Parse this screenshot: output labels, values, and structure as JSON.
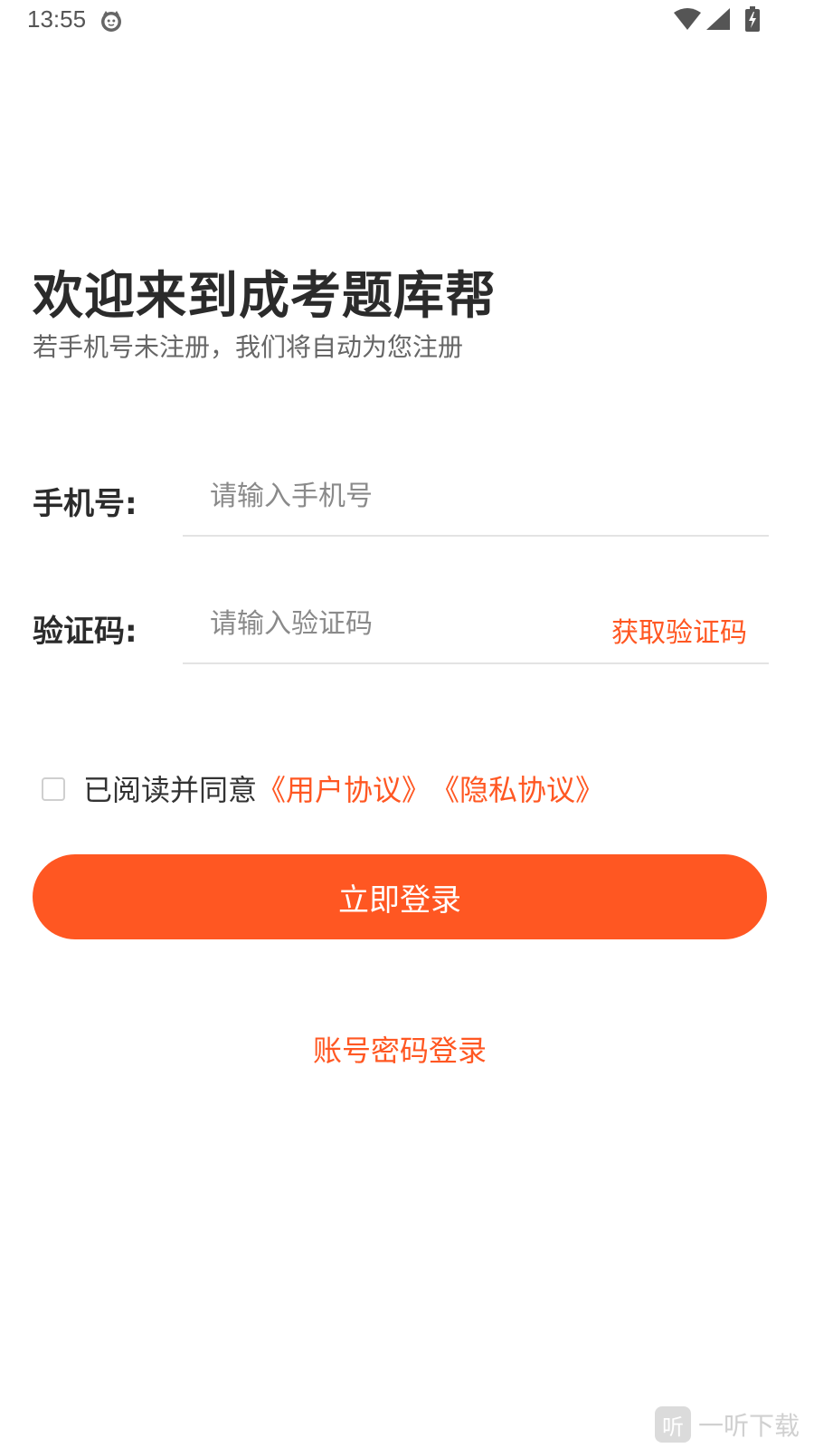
{
  "status_bar": {
    "time": "13:55",
    "icons": [
      "face-icon",
      "wifi-icon",
      "signal-icon",
      "battery-charging-icon"
    ]
  },
  "header": {
    "title": "欢迎来到成考题库帮",
    "subtitle": "若手机号未注册，我们将自动为您注册"
  },
  "form": {
    "phone": {
      "label": "手机号:",
      "placeholder": "请输入手机号",
      "value": ""
    },
    "code": {
      "label": "验证码:",
      "placeholder": "请输入验证码",
      "value": "",
      "get_code_label": "获取验证码"
    }
  },
  "agreement": {
    "checked": false,
    "text": "已阅读并同意",
    "user_agreement": "《用户协议》",
    "privacy_agreement": "《隐私协议》"
  },
  "actions": {
    "login_label": "立即登录",
    "password_login_label": "账号密码登录"
  },
  "watermark": {
    "logo_glyph": "听",
    "text": "一听下载"
  },
  "colors": {
    "accent": "#ff5722",
    "title": "#2b2b2b",
    "subtitle": "#666666",
    "divider": "#e3e3e3"
  }
}
